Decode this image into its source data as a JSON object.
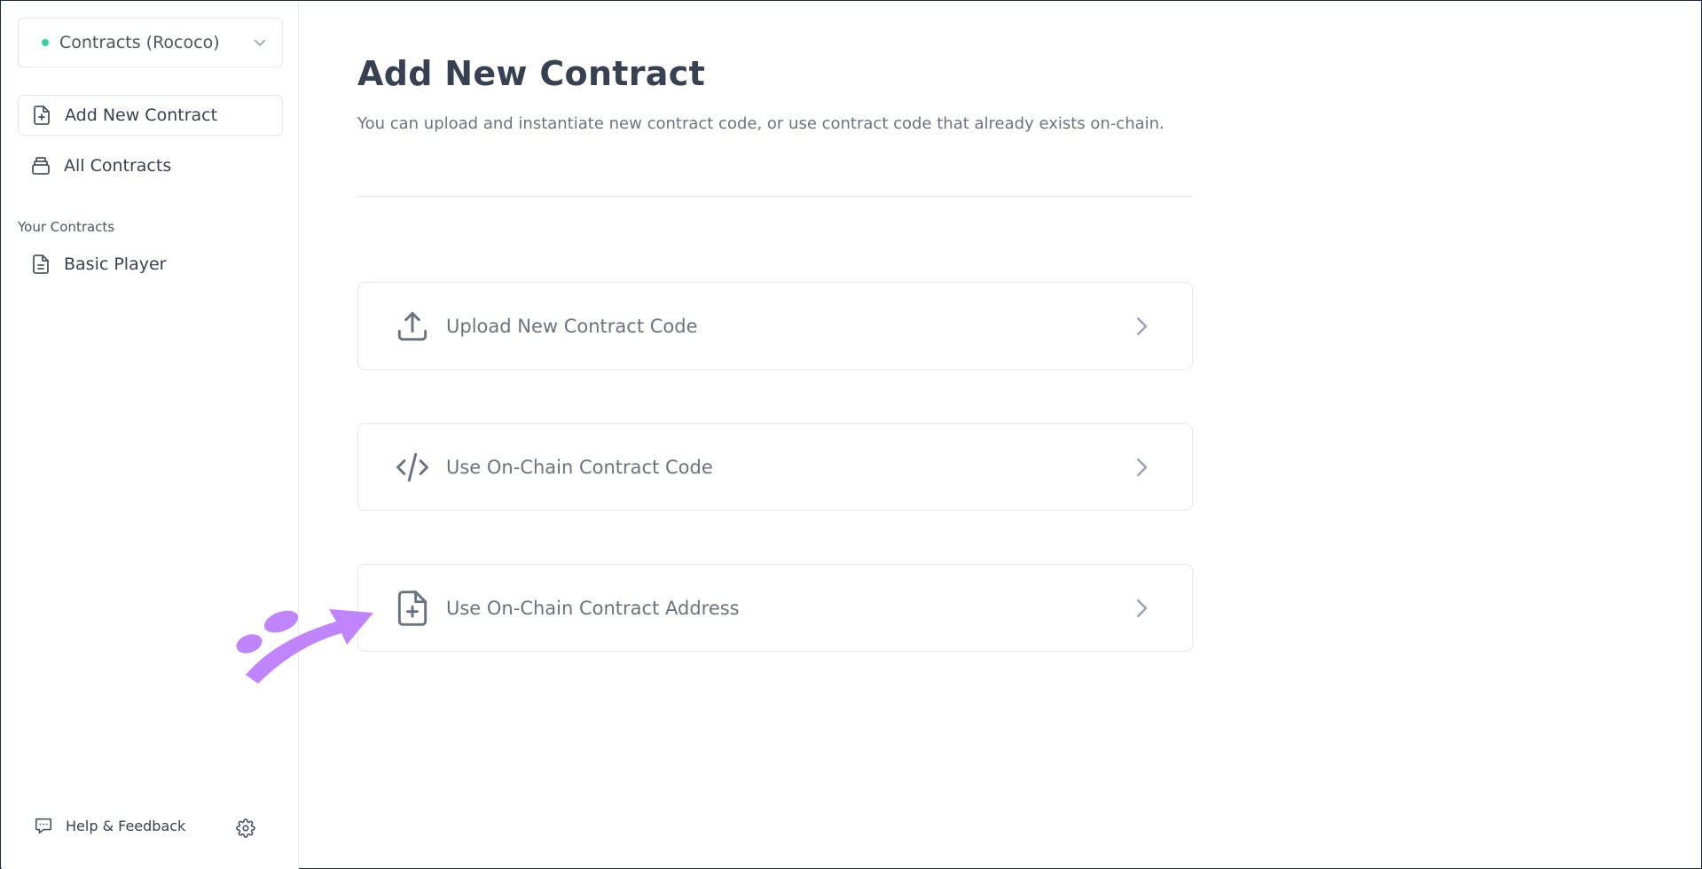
{
  "sidebar": {
    "network": {
      "label": "Contracts (Rococo)",
      "status_color": "#34d399",
      "icon": "chevron-down-icon"
    },
    "nav": [
      {
        "label": "Add New Contract",
        "icon": "file-plus-icon",
        "active": true
      },
      {
        "label": "All Contracts",
        "icon": "collection-icon",
        "active": false
      }
    ],
    "section_title": "Your Contracts",
    "contracts": [
      {
        "label": "Basic Player",
        "icon": "document-icon"
      }
    ],
    "footer": {
      "help_label": "Help & Feedback",
      "help_icon": "chat-alt-icon",
      "settings_icon": "gear-icon"
    }
  },
  "main": {
    "title": "Add New Contract",
    "description": "You can upload and instantiate new contract code, or use contract code that already exists on-chain.",
    "options": [
      {
        "label": "Upload New Contract Code",
        "icon": "upload-icon"
      },
      {
        "label": "Use On-Chain Contract Code",
        "icon": "code-icon"
      },
      {
        "label": "Use On-Chain Contract Address",
        "icon": "file-plus-icon"
      }
    ]
  },
  "colors": {
    "annotation_arrow": "#c084fc",
    "border": "#e5e7eb",
    "text_primary": "#374151",
    "text_secondary": "#6b7280"
  }
}
